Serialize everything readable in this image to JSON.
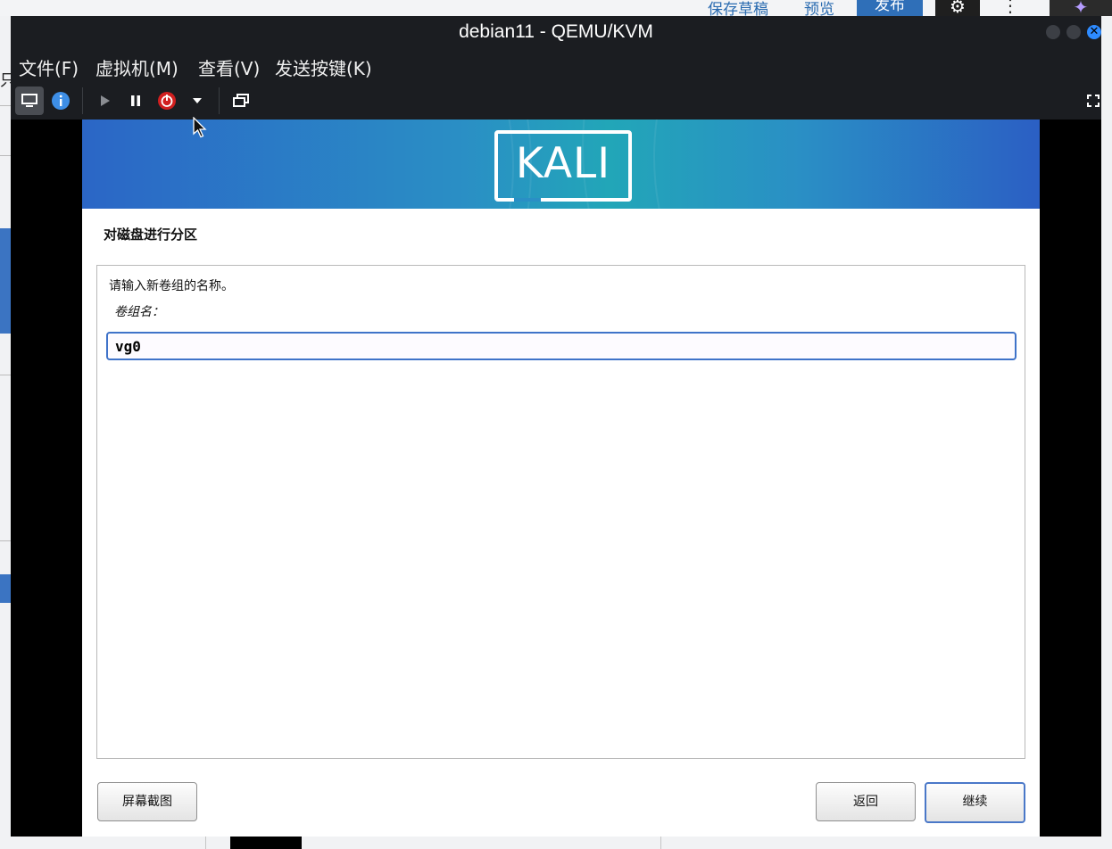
{
  "background_app": {
    "links": [
      "保存草稿",
      "预览"
    ],
    "publish_label": "发布",
    "gear_icon": "gear-icon",
    "more_glyph": "⋮",
    "left_edge_text": "只"
  },
  "window": {
    "title": "debian11 - QEMU/KVM",
    "close_glyph": "✕"
  },
  "menu": {
    "items": [
      "文件(F)",
      "虚拟机(M)",
      "查看(V)",
      "发送按键(K)"
    ]
  },
  "toolbar": {
    "icons": [
      "console-icon",
      "info-icon",
      "run-icon",
      "pause-icon",
      "shutdown-icon",
      "dropdown-arrow-icon",
      "snapshot-icon",
      "fullscreen-icon"
    ]
  },
  "installer": {
    "logo_text": "KALI",
    "step_title": "对磁盘进行分区",
    "prompt": "请输入新卷组的名称。",
    "field_label": "卷组名：",
    "field_value": "vg0",
    "buttons": {
      "screenshot": "屏幕截图",
      "back": "返回",
      "continue": "继续"
    }
  },
  "colors": {
    "titlebar_bg": "#1b1d21",
    "banner_left": "#2b66c6",
    "banner_mid": "#22a6b8",
    "input_border": "#3f73c9",
    "close_button": "#2e8bff"
  }
}
